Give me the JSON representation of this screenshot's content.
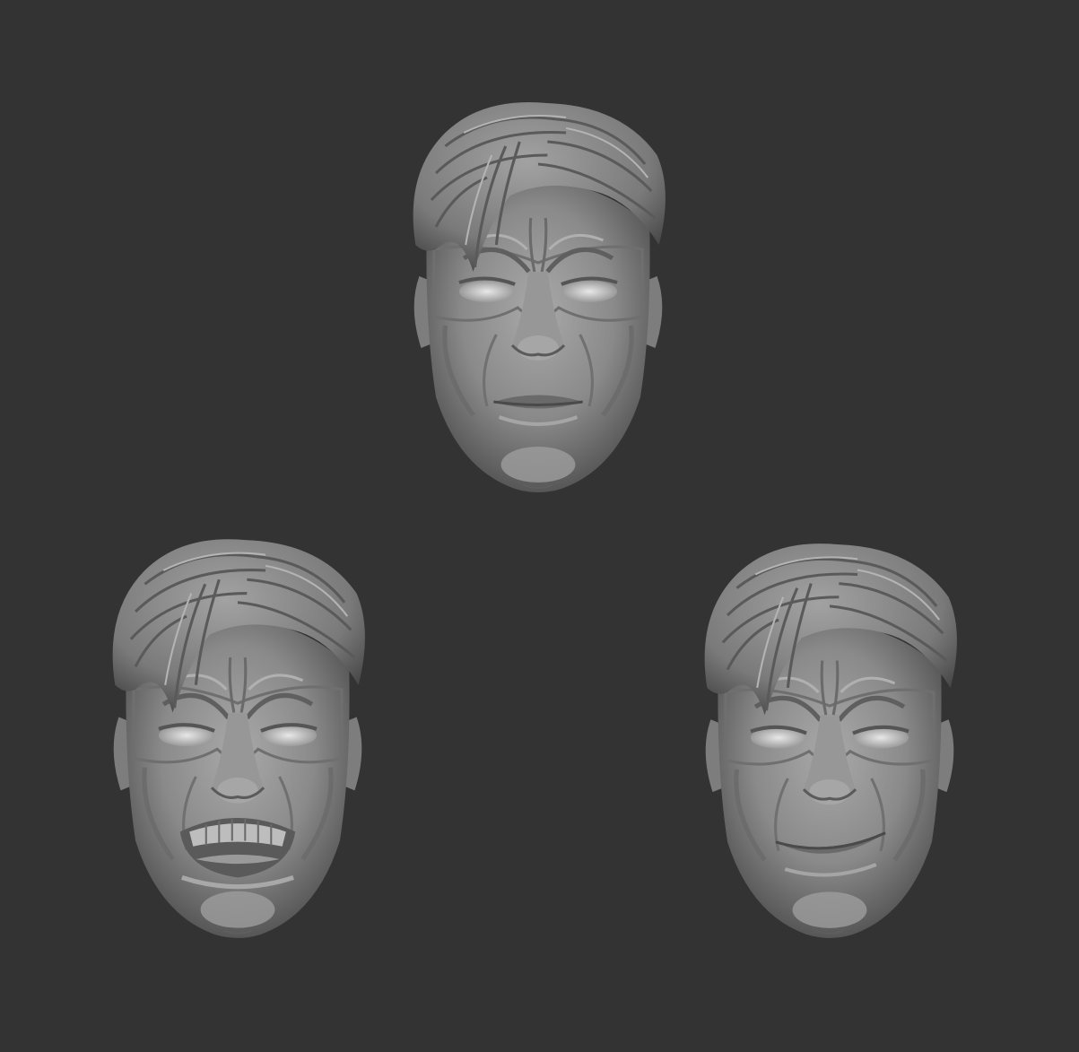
{
  "scene": {
    "background_color": "#333334",
    "material_color": "#8a8a8a",
    "heads": [
      {
        "expression": "neutral",
        "icon": "sculpted-head-neutral-icon"
      },
      {
        "expression": "snarl",
        "icon": "sculpted-head-snarl-icon"
      },
      {
        "expression": "smirk",
        "icon": "sculpted-head-smirk-icon"
      }
    ]
  }
}
